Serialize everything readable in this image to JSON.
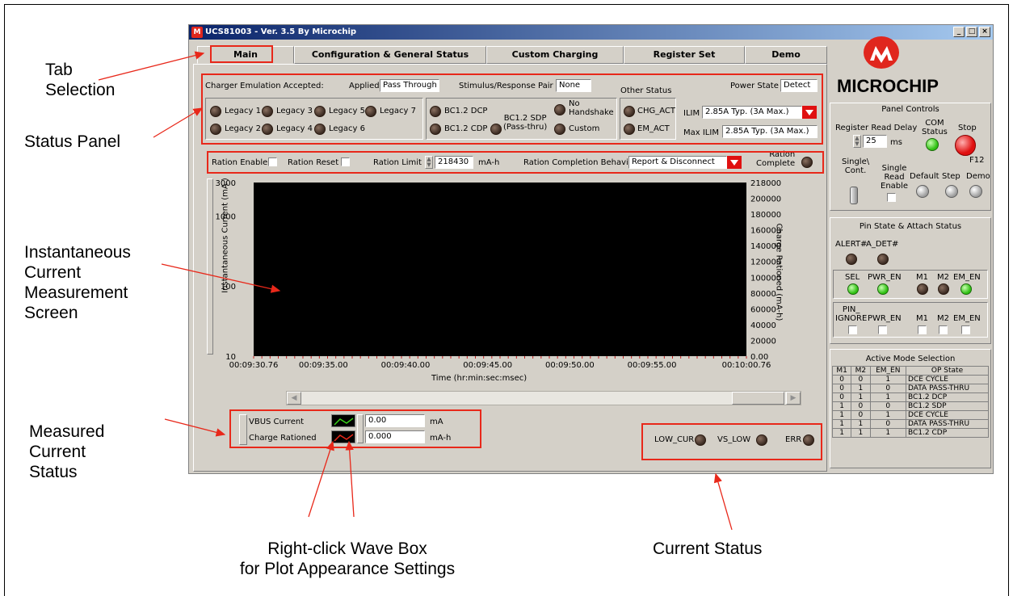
{
  "window": {
    "title": "UCS81003 - Ver. 3.5 By Microchip",
    "controls": [
      "_",
      "□",
      "×"
    ]
  },
  "tabs": [
    {
      "label": "Main",
      "active": true
    },
    {
      "label": "Configuration & General Status"
    },
    {
      "label": "Custom Charging"
    },
    {
      "label": "Register Set"
    },
    {
      "label": "Demo"
    }
  ],
  "annotations": {
    "tab_selection": "Tab\nSelection",
    "status_panel": "Status Panel",
    "instantaneous": "Instantaneous\nCurrent\nMeasurement\nScreen",
    "measured_current": "Measured\nCurrent\nStatus",
    "wave_box": "Right-click Wave Box\nfor Plot Appearance Settings",
    "current_status": "Current Status"
  },
  "status": {
    "charger_emulation_label": "Charger Emulation Accepted:",
    "applied_label": "Applied",
    "applied_value": "Pass Through",
    "stimulus_label": "Stimulus/Response Pair",
    "stimulus_value": "None",
    "other_status_label": "Other Status",
    "power_state_label": "Power State",
    "power_state_value": "Detect",
    "legacy": [
      "Legacy 1",
      "Legacy 3",
      "Legacy 5",
      "Legacy 7",
      "Legacy 2",
      "Legacy 4",
      "Legacy 6"
    ],
    "bc": [
      "BC1.2  DCP",
      "BC1.2 CDP",
      "BC1.2 SDP\n(Pass-thru)",
      "No\nHandshake",
      "Custom"
    ],
    "other": [
      "CHG_ACT",
      "EM_ACT"
    ],
    "ilim_label": "ILIM",
    "ilim_value": "2.85A Typ. (3A Max.)",
    "max_ilim_label": "Max ILIM",
    "max_ilim_value": "2.85A Typ. (3A Max.)"
  },
  "ration": {
    "enable_label": "Ration Enable",
    "reset_label": "Ration Reset",
    "limit_label": "Ration Limit",
    "limit_value": "218430",
    "limit_unit": "mA-h",
    "behavior_label": "Ration Completion Behavior",
    "behavior_value": "Report & Disconnect",
    "complete_label": "Ration\nComplete"
  },
  "chart_data": {
    "type": "line",
    "title": "",
    "xlabel": "Time (hr:min:sec:msec)",
    "ylabel": "Instantaneous Current  (mA )",
    "y2label": "Charge Rationed (mA-h)",
    "y_scale": "log",
    "y_ticks": [
      "3000",
      "1000",
      "100",
      "10"
    ],
    "y2_ticks": [
      "218000",
      "200000",
      "180000",
      "160000",
      "140000",
      "120000",
      "100000",
      "80000",
      "60000",
      "40000",
      "20000",
      "0.00"
    ],
    "x_ticks": [
      "00:09:30.76",
      "00:09:35.00",
      "00:09:40.00",
      "00:09:45.00",
      "00:09:50.00",
      "00:09:55.00",
      "00:10:00.76"
    ],
    "series": [
      {
        "name": "VBUS Current",
        "color": "#3ad21a",
        "values": []
      },
      {
        "name": "Charge Rationed",
        "color": "#e8281a",
        "values": []
      }
    ]
  },
  "measured": {
    "vbus_label": "VBUS Current",
    "vbus_value": "0.00",
    "vbus_unit": "mA",
    "charge_label": "Charge Rationed",
    "charge_value": "0.000",
    "charge_unit": "mA-h"
  },
  "current_status": [
    "LOW_CUR",
    "VS_LOW",
    "ERR"
  ],
  "right": {
    "logo_text": "MICROCHIP",
    "panel_controls_title": "Panel Controls",
    "register_read_delay": "Register Read Delay",
    "delay_value": "25",
    "delay_unit": "ms",
    "com_status": "COM\nStatus",
    "stop": "Stop",
    "f12": "F12",
    "single_cont": "Single\\\nCont.",
    "single_read": "Single\nRead\nEnable",
    "default": "Default",
    "step": "Step",
    "demo": "Demo",
    "pin_state_title": "Pin State & Attach Status",
    "alert": "ALERT#",
    "adet": "A_DET#",
    "pins_row1": [
      "SEL",
      "PWR_EN",
      "M1",
      "M2",
      "EM_EN"
    ],
    "pins_row2": [
      "PIN_\nIGNORE",
      "PWR_EN",
      "M1",
      "M2",
      "EM_EN"
    ],
    "active_mode_title": "Active Mode Selection",
    "mode_headers": [
      "M1",
      "M2",
      "EM_EN",
      "OP State"
    ],
    "mode_rows": [
      [
        "0",
        "0",
        "1",
        "DCE CYCLE"
      ],
      [
        "0",
        "1",
        "0",
        "DATA PASS-THRU"
      ],
      [
        "0",
        "1",
        "1",
        "BC1.2 DCP"
      ],
      [
        "1",
        "0",
        "0",
        "BC1.2 SDP"
      ],
      [
        "1",
        "0",
        "1",
        "DCE CYCLE"
      ],
      [
        "1",
        "1",
        "0",
        "DATA PASS-THRU"
      ],
      [
        "1",
        "1",
        "1",
        "BC1.2 CDP"
      ]
    ]
  }
}
